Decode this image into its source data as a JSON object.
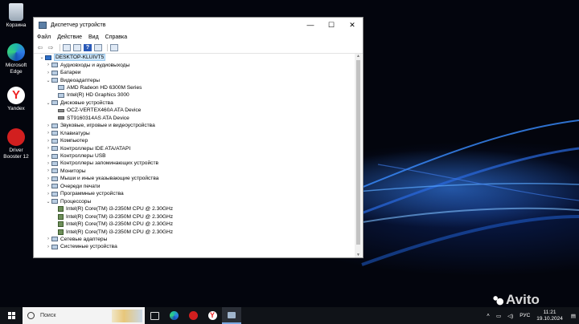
{
  "desktop": {
    "icons": [
      {
        "label_lines": [
          "Корзина"
        ]
      },
      {
        "label_lines": [
          "Microsoft",
          "Edge"
        ]
      },
      {
        "label_lines": [
          "Yandex"
        ]
      },
      {
        "label_lines": [
          "Driver",
          "Booster 12"
        ]
      }
    ]
  },
  "window": {
    "title": "Диспетчер устройств",
    "buttons": {
      "minimize": "—",
      "maximize": "☐",
      "close": "✕"
    },
    "menu": [
      "Файл",
      "Действие",
      "Вид",
      "Справка"
    ],
    "tree": [
      {
        "label": "DESKTOP-KLUIVT5",
        "level": 0,
        "expanded": true,
        "icon": "computer-icon",
        "selected": true
      },
      {
        "label": "Аудиовходы и аудиовыходы",
        "level": 1,
        "expanded": false
      },
      {
        "label": "Батареи",
        "level": 1,
        "expanded": false
      },
      {
        "label": "Видеоадаптеры",
        "level": 1,
        "expanded": true
      },
      {
        "label": "AMD Radeon HD 6300M Series",
        "level": 2
      },
      {
        "label": "Intel(R) HD Graphics 3000",
        "level": 2
      },
      {
        "label": "Дисковые устройства",
        "level": 1,
        "expanded": true
      },
      {
        "label": "OCZ-VERTEX460A ATA Device",
        "level": 2,
        "icon": "disk-icon"
      },
      {
        "label": "ST9160314AS ATA Device",
        "level": 2,
        "icon": "disk-icon"
      },
      {
        "label": "Звуковые, игровые и видеоустройства",
        "level": 1,
        "expanded": false
      },
      {
        "label": "Клавиатуры",
        "level": 1,
        "expanded": false
      },
      {
        "label": "Компьютер",
        "level": 1,
        "expanded": false
      },
      {
        "label": "Контроллеры IDE ATA/ATAPI",
        "level": 1,
        "expanded": false
      },
      {
        "label": "Контроллеры USB",
        "level": 1,
        "expanded": false
      },
      {
        "label": "Контроллеры запоминающих устройств",
        "level": 1,
        "expanded": false
      },
      {
        "label": "Мониторы",
        "level": 1,
        "expanded": false
      },
      {
        "label": "Мыши и иные указывающие устройства",
        "level": 1,
        "expanded": false
      },
      {
        "label": "Очереди печати",
        "level": 1,
        "expanded": false
      },
      {
        "label": "Программные устройства",
        "level": 1,
        "expanded": false
      },
      {
        "label": "Процессоры",
        "level": 1,
        "expanded": true
      },
      {
        "label": "Intel(R) Core(TM) i3-2350M CPU @ 2.30GHz",
        "level": 2,
        "icon": "cpu-icon"
      },
      {
        "label": "Intel(R) Core(TM) i3-2350M CPU @ 2.30GHz",
        "level": 2,
        "icon": "cpu-icon"
      },
      {
        "label": "Intel(R) Core(TM) i3-2350M CPU @ 2.30GHz",
        "level": 2,
        "icon": "cpu-icon"
      },
      {
        "label": "Intel(R) Core(TM) i3-2350M CPU @ 2.30GHz",
        "level": 2,
        "icon": "cpu-icon"
      },
      {
        "label": "Сетевые адаптеры",
        "level": 1,
        "expanded": false
      },
      {
        "label": "Системные устройства",
        "level": 1,
        "expanded": false
      }
    ]
  },
  "taskbar": {
    "search_placeholder": "Поиск",
    "language": "РУС",
    "time": "11:21",
    "date": "19.10.2024"
  },
  "watermark": "Avito"
}
